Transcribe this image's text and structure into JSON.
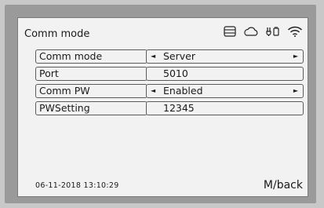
{
  "screen": {
    "title": "Comm mode",
    "datetime": "06-11-2018  13:10:29",
    "back_label": "M/back"
  },
  "status_icons": [
    "storage-icon",
    "cloud-icon",
    "plug-icon",
    "wifi-icon"
  ],
  "menu": {
    "rows": [
      {
        "label": "Comm mode",
        "value": "Server",
        "selectable": true
      },
      {
        "label": "Port",
        "value": "5010",
        "selectable": false
      },
      {
        "label": "Comm PW",
        "value": "Enabled",
        "selectable": true
      },
      {
        "label": "PWSetting",
        "value": "12345",
        "selectable": false
      }
    ]
  },
  "glyphs": {
    "left_arrow": "◄",
    "right_arrow": "►"
  }
}
